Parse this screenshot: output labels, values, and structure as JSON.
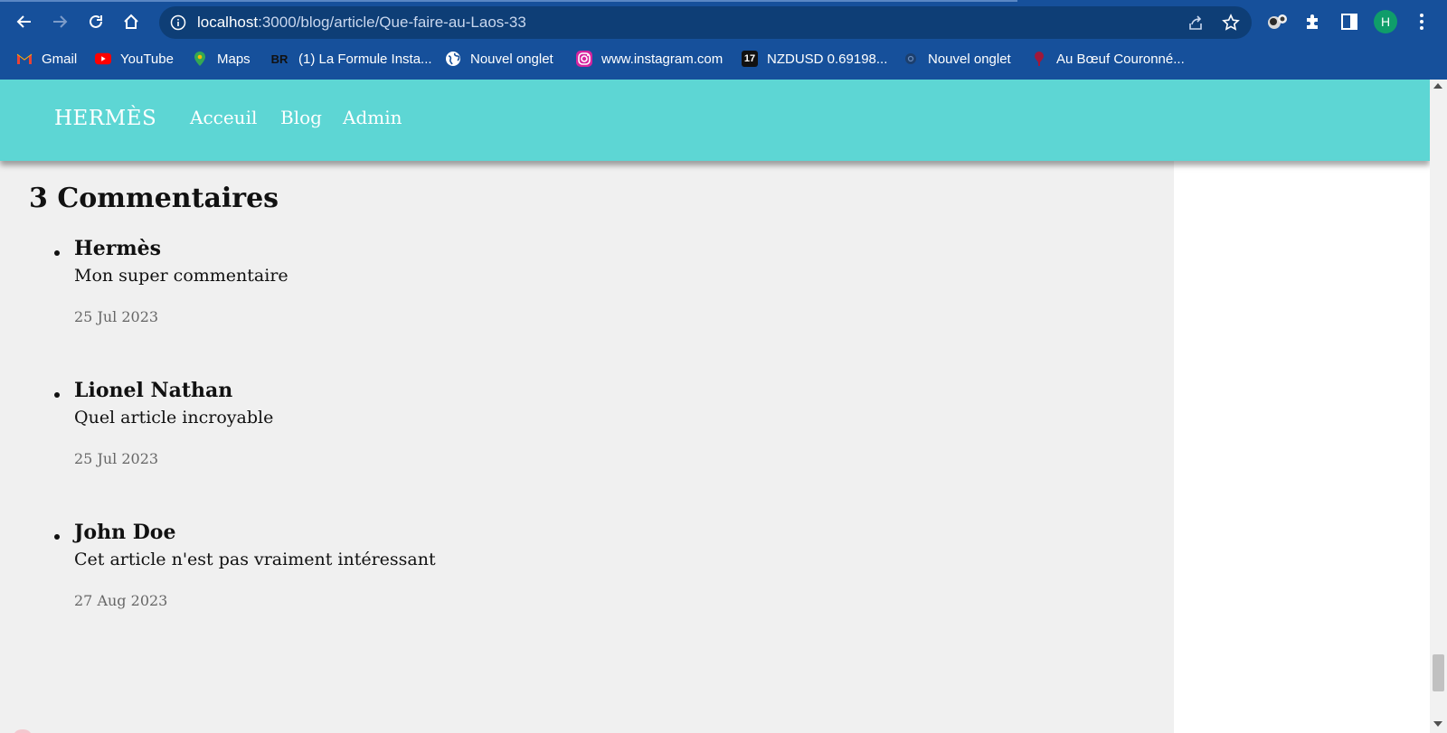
{
  "browser": {
    "url_host": "localhost",
    "url_path": ":3000/blog/article/Que-faire-au-Laos-33",
    "profile_initial": "H",
    "bookmarks": [
      {
        "label": "Gmail",
        "icon": "gmail-icon"
      },
      {
        "label": "YouTube",
        "icon": "youtube-icon"
      },
      {
        "label": "Maps",
        "icon": "maps-icon"
      },
      {
        "label": "(1) La Formule Insta...",
        "icon": "br-icon",
        "icon_text": "BR"
      },
      {
        "label": "Nouvel onglet",
        "icon": "globe-icon"
      },
      {
        "label": "www.instagram.com",
        "icon": "instagram-icon"
      },
      {
        "label": "NZDUSD 0.69198...",
        "icon": "tradingview-icon",
        "icon_text": "17"
      },
      {
        "label": "Nouvel onglet",
        "icon": "new-tab-icon"
      },
      {
        "label": "Au Bœuf Couronné...",
        "icon": "restaurant-icon"
      }
    ]
  },
  "site": {
    "brand": "HERMÈS",
    "nav": [
      "Acceuil",
      "Blog",
      "Admin"
    ],
    "header_color": "#5dd6d4"
  },
  "comments": {
    "title": "3 Commentaires",
    "items": [
      {
        "author": "Hermès",
        "text": "Mon super commentaire",
        "date": "25 Jul 2023"
      },
      {
        "author": "Lionel Nathan",
        "text": "Quel article incroyable",
        "date": "25 Jul 2023"
      },
      {
        "author": "John Doe",
        "text": "Cet article n'est pas vraiment intéressant",
        "date": "27 Aug 2023"
      }
    ]
  }
}
